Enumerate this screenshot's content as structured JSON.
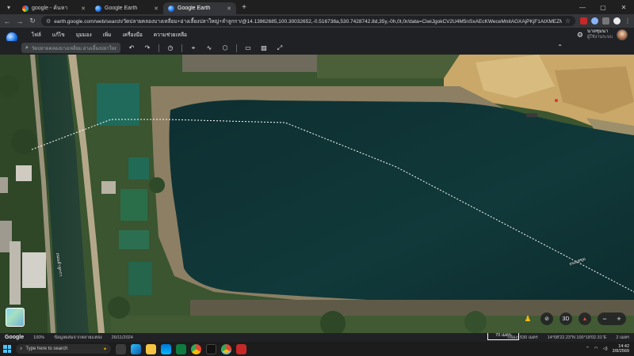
{
  "browser": {
    "tabs": [
      {
        "title": "google - ค้นหา",
        "favicon": "google-icon",
        "active": false
      },
      {
        "title": "Google Earth",
        "favicon": "earth-icon",
        "active": false
      },
      {
        "title": "Google Earth",
        "favicon": "earth-icon",
        "active": true
      }
    ],
    "new_tab": "+",
    "window_controls": [
      "—",
      "▢",
      "✕"
    ],
    "address": "earth.google.com/web/search/วัดปลายคลองบางเหลี่ยม+อ่างเลี้ยงปลาใหญ่+ลำลูกกา/@14.13962685,100.30032652,-0.516738a,530.7428742.8d,35y,-0h,0t,0r/data=CiwiJgokCV2U4M5nSxAEcKWeceMnitAGXAjPKjF1AtXMEZMdw88AQgIASb0CgEwQgIIAEoNCP___"
  },
  "earth_menu": {
    "items": [
      "ไฟล์",
      "แก้ไข",
      "มุมมอง",
      "เพิ่ม",
      "เครื่องมือ",
      "ความช่วยเหลือ"
    ],
    "account_name": "นายชุมนา",
    "account_sub": "ผู้ใช้งานระบบ"
  },
  "earth_search": {
    "placeholder": "วัดปลายคลองบางเหลี่ยม อ่างเลี้ยงปลาใหญ่ อำ..."
  },
  "map": {
    "labels": {
      "road_vertical": "ถนนลำลูกกา",
      "measure": "ถนนสุขุม"
    }
  },
  "status_bar": {
    "logo": "Google",
    "zoom": "100%",
    "data_source": "ข้อมูลผสมจากหลายแหล่ง",
    "date": "26/11/2024",
    "scale": "70 เมตร",
    "camera": "กล้อง: 530 เมตร",
    "coords": "14°08'22.23\"N 100°18'02.31\"E",
    "elevation": "2 เมตร"
  },
  "taskbar": {
    "search_placeholder": "Type here to search",
    "time": "14:42",
    "date": "2/8/2569"
  },
  "colors": {
    "water": "#0f3335",
    "grass": "#3f5a2e",
    "sand": "#c9a86a",
    "bank": "#9b8a6c",
    "accent": "#1a73e8"
  }
}
